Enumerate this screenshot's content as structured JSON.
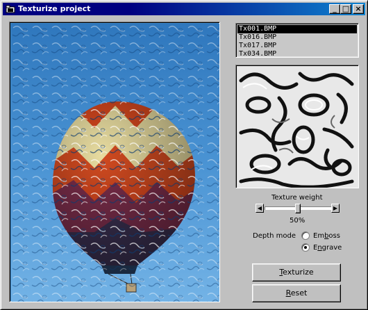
{
  "window": {
    "title": "Texturize project"
  },
  "titlebar_buttons": {
    "minimize": "_",
    "maximize": "□",
    "close": "×"
  },
  "texture_list": {
    "items": [
      "Tx001.BMP",
      "Tx016.BMP",
      "Tx017.BMP",
      "Tx034.BMP"
    ],
    "selected_index": 0
  },
  "texture_weight": {
    "label": "Texture weight",
    "value_label": "50%",
    "value": 0.5,
    "left_arrow": "◀",
    "right_arrow": "▶"
  },
  "depth_mode": {
    "label": "Depth mode",
    "emboss": {
      "label_pre": "Em",
      "label_ul": "b",
      "label_post": "oss",
      "checked": false
    },
    "engrave": {
      "label_pre": "E",
      "label_ul": "n",
      "label_post": "grave",
      "checked": true
    }
  },
  "buttons": {
    "texturize": {
      "ul": "T",
      "rest": "exturize"
    },
    "reset": {
      "ul": "R",
      "rest": "eset"
    }
  },
  "icons": {
    "app": "folder-icon",
    "photo": "hot-air-balloon-photo",
    "texture": "texture-preview"
  }
}
